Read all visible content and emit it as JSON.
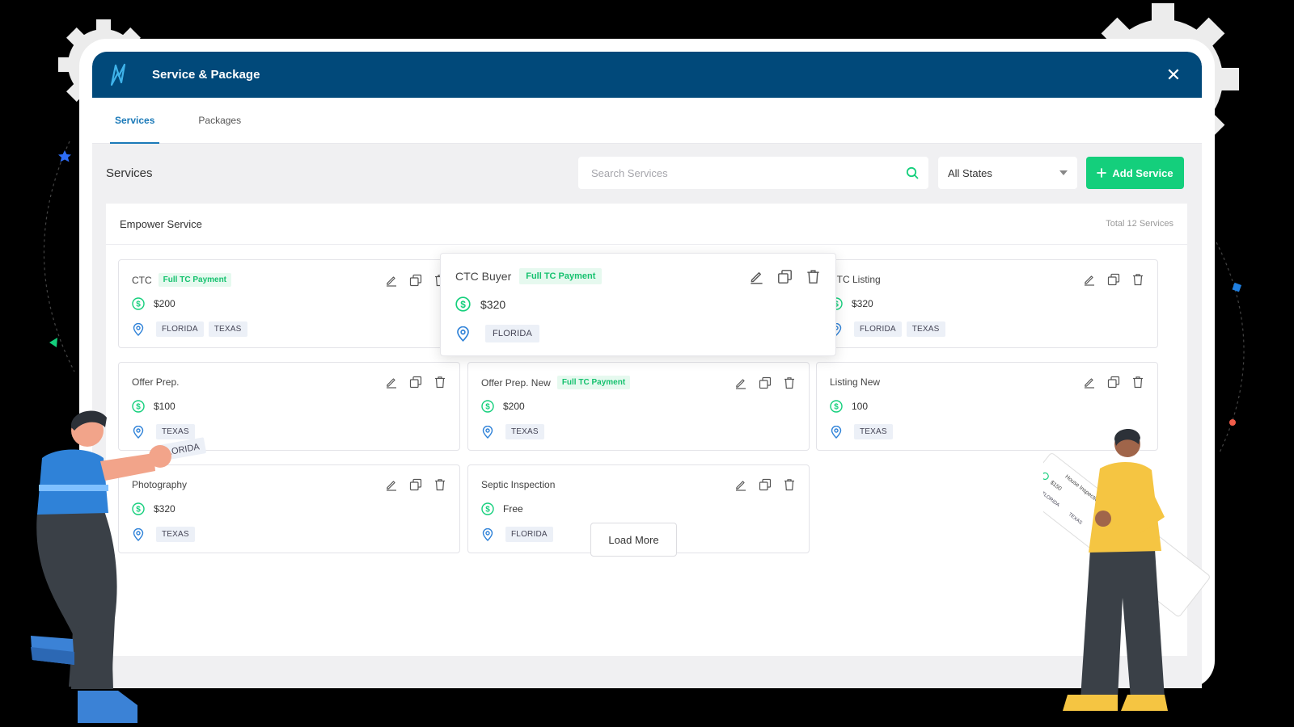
{
  "modal": {
    "title": "Service & Package",
    "close_label": "✕"
  },
  "tabs": [
    {
      "label": "Services",
      "active": true
    },
    {
      "label": "Packages",
      "active": false
    }
  ],
  "toolbar": {
    "section_title": "Services",
    "search_placeholder": "Search Services",
    "state_select": "All States",
    "add_label": "Add Service"
  },
  "panel": {
    "title": "Empower Service",
    "total": "Total 12 Services"
  },
  "services": [
    {
      "name": "CTC",
      "badge": "Full TC Payment",
      "price": "$200",
      "states": [
        "FLORIDA",
        "TEXAS"
      ]
    },
    {
      "name": "CTC Buyer",
      "badge": "Full TC Payment",
      "price": "$320",
      "states": [
        "FLORIDA"
      ]
    },
    {
      "name": "CTC Listing",
      "badge": "",
      "price": "$320",
      "states": [
        "FLORIDA",
        "TEXAS"
      ]
    },
    {
      "name": "Offer Prep.",
      "badge": "",
      "price": "$100",
      "states": [
        "TEXAS"
      ]
    },
    {
      "name": "Offer Prep. New",
      "badge": "Full TC Payment",
      "price": "$200",
      "states": [
        "TEXAS"
      ]
    },
    {
      "name": "Listing New",
      "badge": "",
      "price": "100",
      "states": [
        "TEXAS"
      ]
    },
    {
      "name": "Photography",
      "badge": "",
      "price": "$320",
      "states": [
        "TEXAS"
      ]
    },
    {
      "name": "Septic Inspection",
      "badge": "",
      "price": "Free",
      "states": [
        "FLORIDA"
      ]
    }
  ],
  "floating_tag": "FLORIDA",
  "load_more_label": "Load More",
  "illustration_card": {
    "name": "House Inspection",
    "price": "$150",
    "states": [
      "FLORIDA",
      "TEXAS"
    ]
  },
  "colors": {
    "header": "#01497a",
    "accent": "#1a79b8",
    "green": "#14cf7c",
    "badge_text": "#16c26f"
  },
  "icons": {
    "logo": "bolt-logo-icon",
    "close": "close-icon",
    "search": "search-icon",
    "dropdown": "chevron-down-icon",
    "add": "plus-icon",
    "edit": "pencil-icon",
    "duplicate": "copy-icon",
    "delete": "trash-icon",
    "price": "dollar-circle-icon",
    "location": "map-pin-icon"
  }
}
